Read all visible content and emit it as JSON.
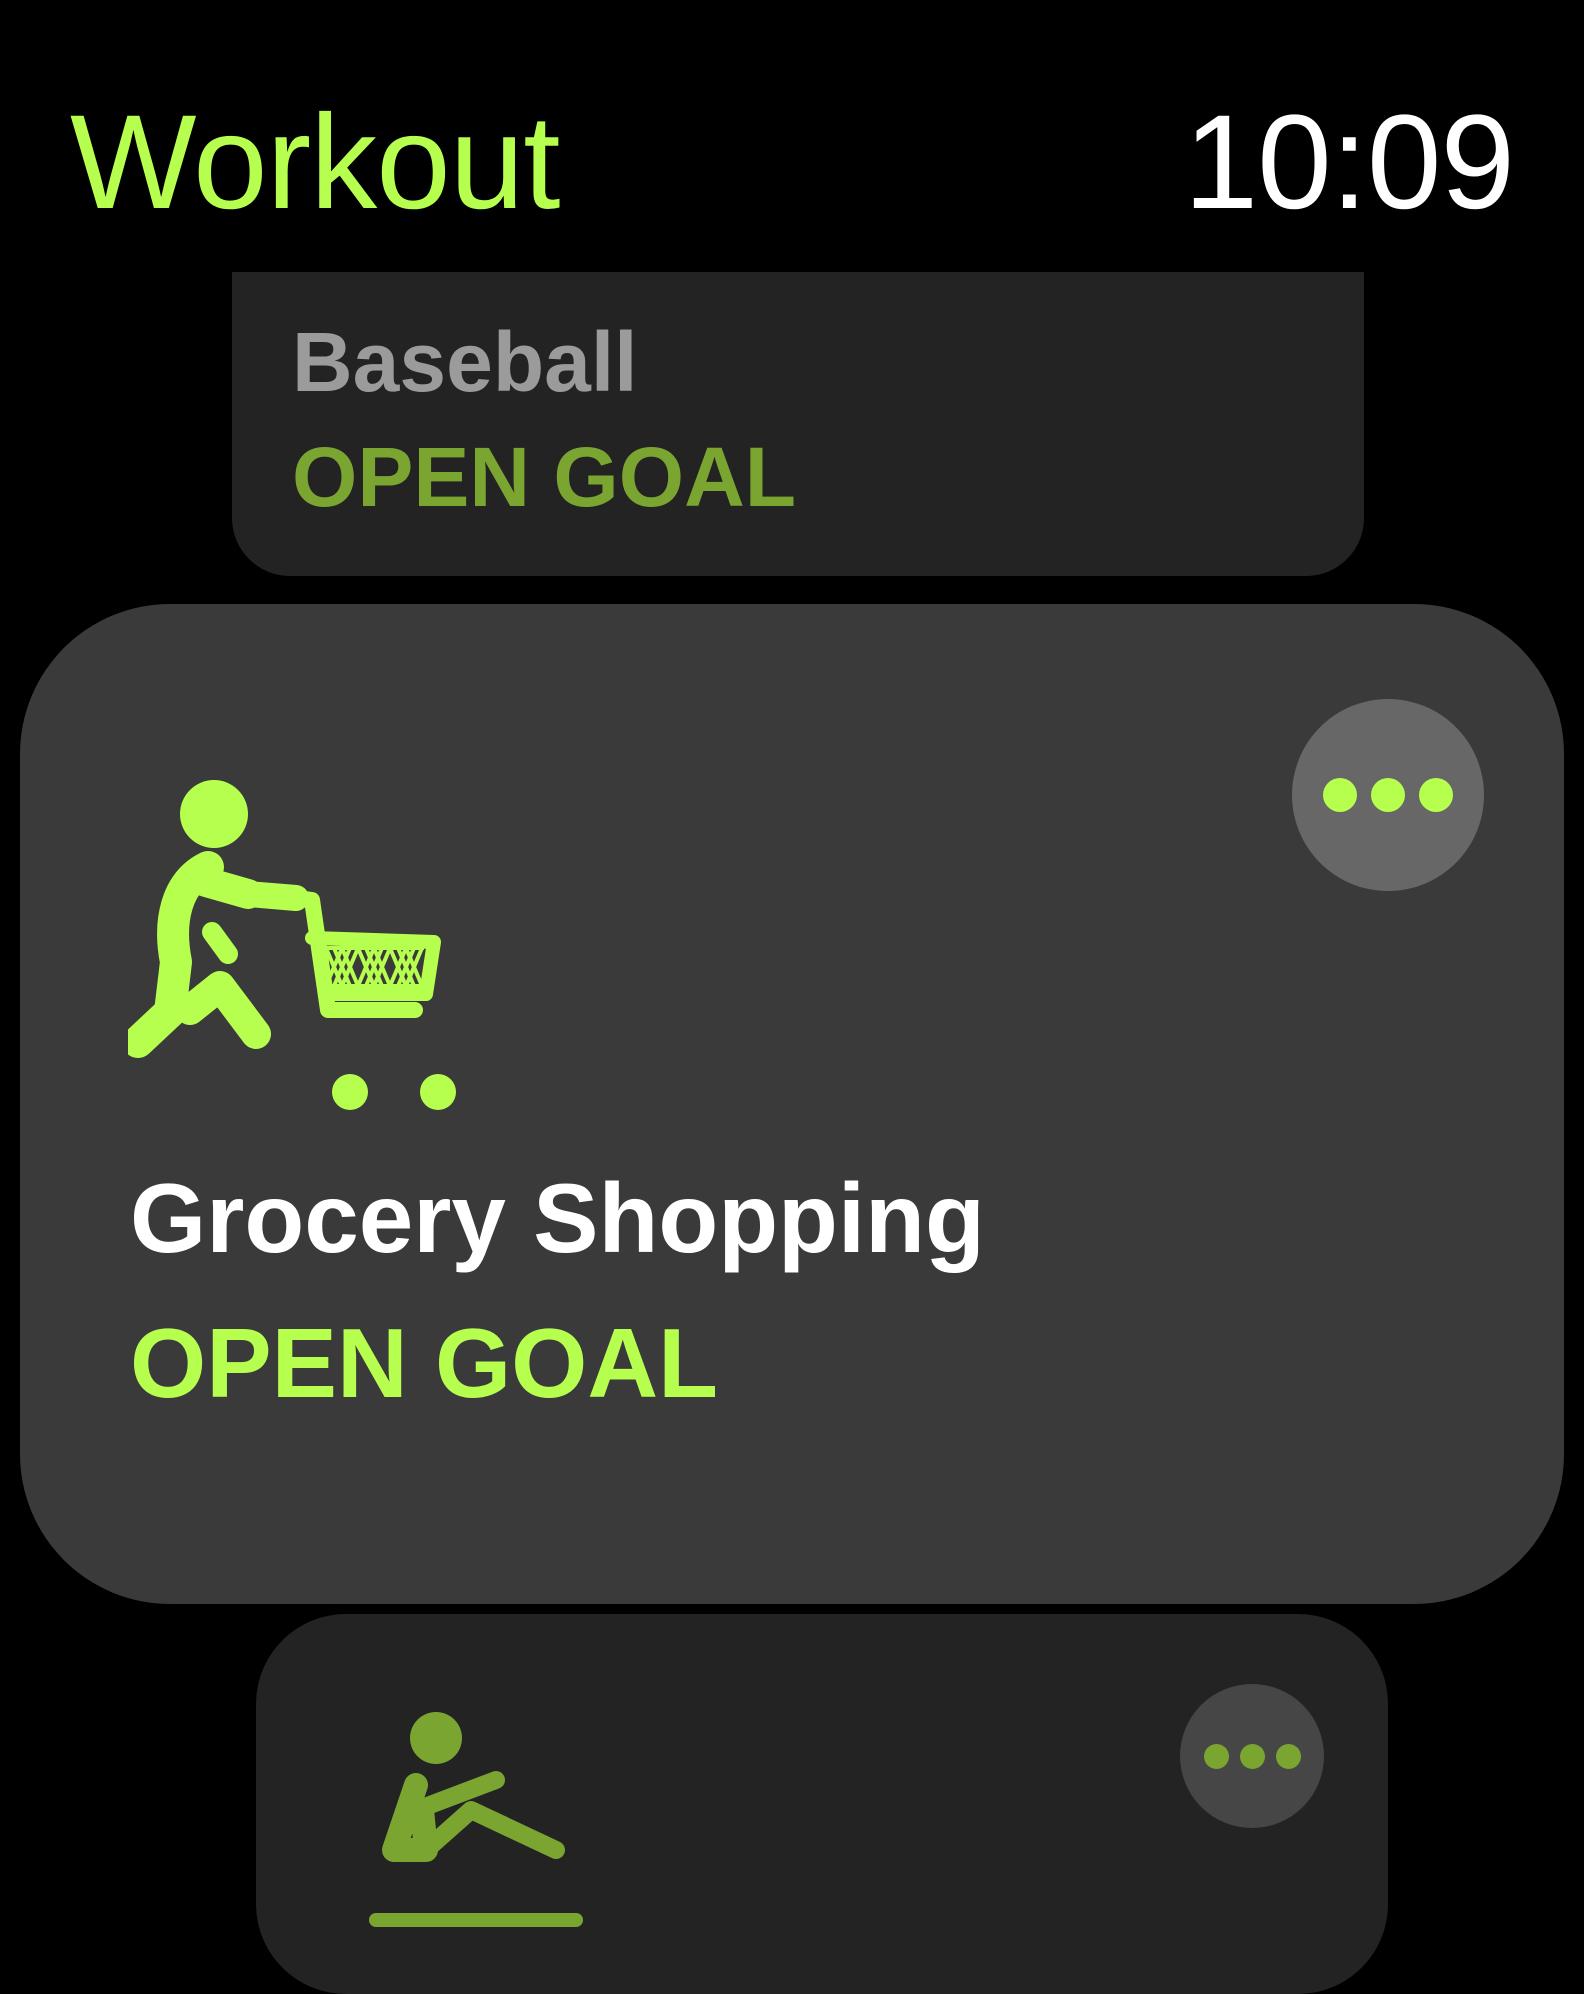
{
  "header": {
    "title": "Workout",
    "time": "10:09"
  },
  "colors": {
    "accent": "#b7ff4f",
    "accent_dim": "#7ba531",
    "card_bg": "#3a3a3a",
    "card_bg_dim": "#232323",
    "text_white": "#ffffff",
    "text_dim": "#9b9b9b",
    "button_bg": "#676767",
    "button_bg_dim": "#464646"
  },
  "workouts": [
    {
      "name": "Baseball",
      "goal": "OPEN GOAL"
    },
    {
      "name": "Grocery Shopping",
      "goal": "OPEN GOAL",
      "icon": "grocery-cart-person-icon"
    },
    {
      "icon": "rowing-person-icon"
    }
  ]
}
